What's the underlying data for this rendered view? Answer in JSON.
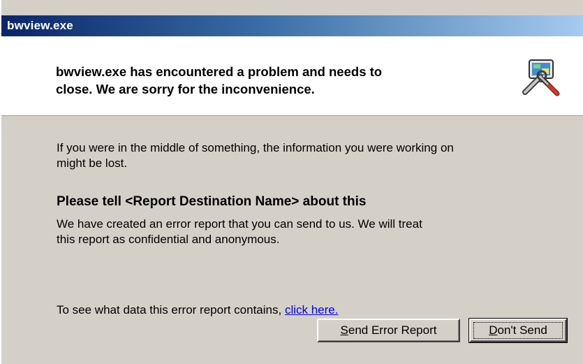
{
  "window": {
    "title": "bwview.exe"
  },
  "header": {
    "message": "bwview.exe has encountered a problem and needs to\nclose.  We are sorry for the inconvenience.",
    "icon": "error-report-tools-icon"
  },
  "body": {
    "info_text": "If you were in the middle of something, the information you were working on\nmight be lost.",
    "heading": "Please tell <Report Destination Name> about this",
    "report_text": "We have created an error report that you can send to us.  We will treat\nthis report as confidential and anonymous.",
    "see_data_prefix": "To see what data this error report contains, ",
    "click_here_link": "click here."
  },
  "buttons": {
    "send_mnemonic": "S",
    "send_rest": "end Error Report",
    "dont_mnemonic": "D",
    "dont_rest": "on't Send"
  },
  "colors": {
    "titlebar_start": "#0a246a",
    "titlebar_end": "#a6caf0",
    "dialog_face": "#d4d0c8",
    "link": "#0000ee"
  }
}
